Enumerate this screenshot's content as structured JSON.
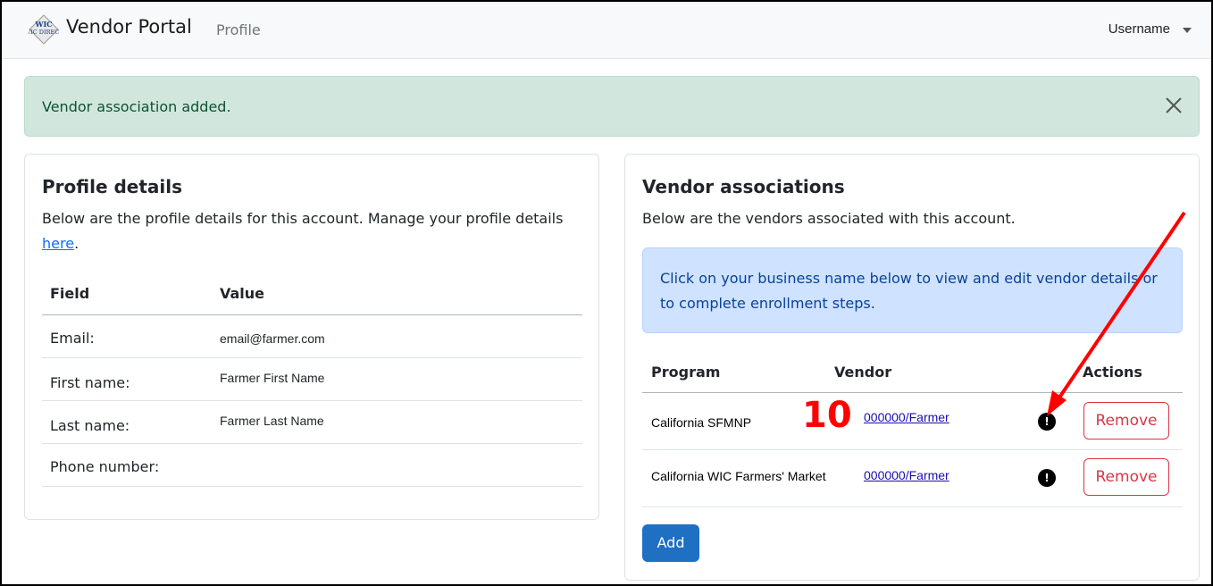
{
  "navbar": {
    "logo_text": "WIC DIRECT",
    "brand": "Vendor Portal",
    "page": "Profile",
    "username": "Username"
  },
  "alert": {
    "message": "Vendor association added."
  },
  "profile": {
    "title": "Profile details",
    "description": "Below are the profile details for this account. Manage your profile details",
    "link_text": "here",
    "period": ".",
    "headers": {
      "field": "Field",
      "value": "Value"
    },
    "rows": [
      {
        "field": "Email:",
        "value": "email@farmer.com"
      },
      {
        "field": "First name:",
        "value": "Farmer First Name"
      },
      {
        "field": "Last name:",
        "value": "Farmer Last Name"
      },
      {
        "field": "Phone number:",
        "value": ""
      }
    ]
  },
  "vendors": {
    "title": "Vendor associations",
    "description": "Below are the vendors associated with this account.",
    "info": "Click on your business name below to view and edit vendor details or to complete enrollment steps.",
    "headers": {
      "program": "Program",
      "vendor": "Vendor",
      "actions": "Actions"
    },
    "rows": [
      {
        "program": "California SFMNP",
        "vendor": "000000/Farmer",
        "status_icon": "exclamation-circle-icon",
        "action": "Remove"
      },
      {
        "program": "California WIC Farmers' Market",
        "vendor": "000000/Farmer",
        "status_icon": "exclamation-circle-icon",
        "action": "Remove"
      }
    ],
    "add_label": "Add"
  },
  "annotation": {
    "number": "10",
    "color": "#ff0000"
  },
  "colors": {
    "alert_bg": "#d1e7dd",
    "info_bg": "#cfe2ff",
    "primary": "#1f6fc3",
    "danger": "#dc3545"
  }
}
